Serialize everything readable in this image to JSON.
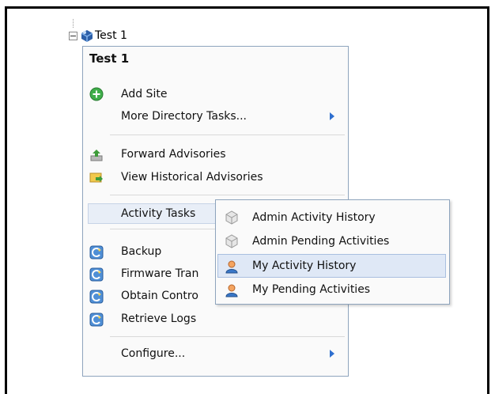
{
  "tree": {
    "node_label": "Test 1"
  },
  "context_menu": {
    "header": "Test 1",
    "items": [
      {
        "label": "Add Site",
        "icon": "add-icon"
      },
      {
        "label": "More Directory Tasks...",
        "icon": "",
        "submenu": true
      },
      {
        "label": "Forward Advisories",
        "icon": "forward-advisories-icon"
      },
      {
        "label": "View Historical Advisories",
        "icon": "historical-advisories-icon"
      },
      {
        "label": "Activity Tasks",
        "icon": "",
        "submenu": true
      },
      {
        "label": "Backup",
        "icon": "refresh-icon"
      },
      {
        "label": "Firmware Tran",
        "icon": "refresh-icon"
      },
      {
        "label": "Obtain Contro",
        "icon": "refresh-icon"
      },
      {
        "label": "Retrieve Logs",
        "icon": "refresh-icon"
      },
      {
        "label": "Configure...",
        "icon": "",
        "submenu": true
      }
    ]
  },
  "submenu": {
    "items": [
      {
        "label": "Admin Activity History",
        "icon": "admin-cube-icon"
      },
      {
        "label": "Admin Pending Activities",
        "icon": "admin-cube-icon"
      },
      {
        "label": "My Activity History",
        "icon": "user-icon"
      },
      {
        "label": "My Pending Activities",
        "icon": "user-icon"
      }
    ]
  },
  "colors": {
    "menu_border": "#8ea4bd",
    "highlight": "#dfe8f6",
    "arrow": "#2f6fcf"
  }
}
